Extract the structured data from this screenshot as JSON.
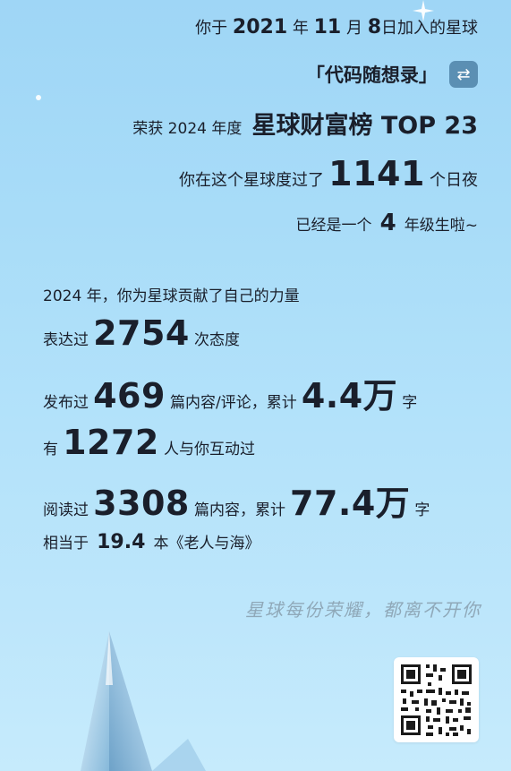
{
  "join": {
    "prefix": "你于",
    "year": "2021",
    "year_unit": "年",
    "month": "11",
    "month_unit": "月",
    "day": "8",
    "suffix": "日加入的星球"
  },
  "planet": {
    "name": "「代码随想录」",
    "swap_icon": "swap-icon"
  },
  "honor": {
    "prefix": "荣获 2024 年度",
    "title": "星球财富榜 TOP 23"
  },
  "days": {
    "prefix": "你在这个星球度过了",
    "value": "1141",
    "suffix": "个日夜"
  },
  "grade": {
    "prefix": "已经是一个",
    "value": "4",
    "suffix": "年级生啦~"
  },
  "stats": {
    "intro": "2024 年，你为星球贡献了自己的力量",
    "attitude": {
      "prefix": "表达过",
      "value": "2754",
      "suffix": "次态度"
    },
    "posts": {
      "prefix": "发布过",
      "value": "469",
      "middle": "篇内容/评论，累计",
      "words": "4.4万",
      "suffix": "字"
    },
    "interact": {
      "prefix": "有",
      "value": "1272",
      "suffix": "人与你互动过"
    },
    "read": {
      "prefix": "阅读过",
      "value": "3308",
      "middle": "篇内容，累计",
      "words": "77.4万",
      "suffix": "字"
    },
    "equiv": {
      "prefix": "相当于",
      "value": "19.4",
      "suffix": "本《老人与海》"
    }
  },
  "slogan": "星球每份荣耀，都离不开你",
  "icons": {
    "qr": "qr-code-icon",
    "crystal": "crystal-decoration-icon",
    "sparkle": "sparkle-icon"
  }
}
